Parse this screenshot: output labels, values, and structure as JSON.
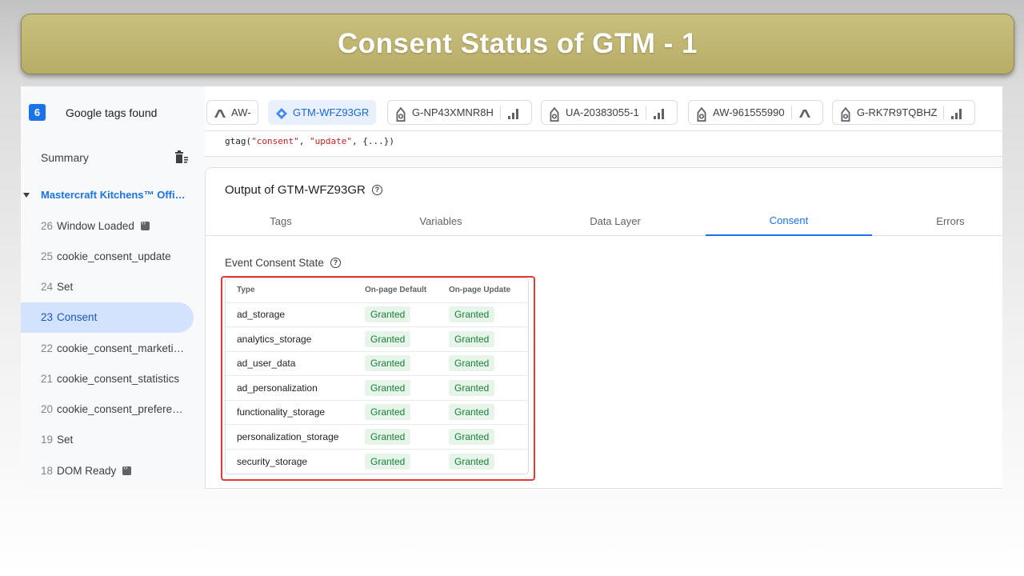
{
  "banner": {
    "title": "Consent Status of GTM - 1"
  },
  "sidebar": {
    "tags_count": "6",
    "tags_found_label": "Google tags found",
    "summary_label": "Summary",
    "container_label": "Mastercraft Kitchens™ Offi…",
    "events": [
      {
        "num": "26",
        "label": "Window Loaded",
        "code_icon": true
      },
      {
        "num": "25",
        "label": "cookie_consent_update",
        "code_icon": false
      },
      {
        "num": "24",
        "label": "Set",
        "code_icon": false
      },
      {
        "num": "23",
        "label": "Consent",
        "code_icon": false,
        "active": true
      },
      {
        "num": "22",
        "label": "cookie_consent_marketi…",
        "code_icon": false
      },
      {
        "num": "21",
        "label": "cookie_consent_statistics",
        "code_icon": false
      },
      {
        "num": "20",
        "label": "cookie_consent_prefere…",
        "code_icon": false
      },
      {
        "num": "19",
        "label": "Set",
        "code_icon": false
      },
      {
        "num": "18",
        "label": "DOM Ready",
        "code_icon": true
      }
    ]
  },
  "tag_tabs": [
    {
      "label": "AW-",
      "icon": "google-ads-icon"
    },
    {
      "label": "GTM-WFZ93GR",
      "icon": "gtm-diamond-icon",
      "active": true
    },
    {
      "label": "G-NP43XMNR8H",
      "icon": "google-tag-icon",
      "trailing_icon": "analytics-bars-icon"
    },
    {
      "label": "UA-20383055-1",
      "icon": "google-tag-icon",
      "trailing_icon": "analytics-bars-icon"
    },
    {
      "label": "AW-961555990",
      "icon": "google-tag-icon",
      "trailing_icon": "google-ads-icon"
    },
    {
      "label": "G-RK7R9TQBHZ",
      "icon": "google-tag-icon",
      "trailing_icon": "analytics-bars-icon"
    }
  ],
  "code_strip": {
    "prefix": "gtag(",
    "arg1": "\"consent\"",
    "sep": ", ",
    "arg2": "\"update\"",
    "suffix": ", {...})"
  },
  "output": {
    "title": "Output of GTM-WFZ93GR",
    "tabs": [
      "Tags",
      "Variables",
      "Data Layer",
      "Consent",
      "Errors"
    ],
    "active_tab": "Consent",
    "section_title": "Event Consent State",
    "table": {
      "headers": {
        "type": "Type",
        "default": "On-page Default",
        "update": "On-page Update"
      },
      "rows": [
        {
          "type": "ad_storage",
          "default": "Granted",
          "update": "Granted"
        },
        {
          "type": "analytics_storage",
          "default": "Granted",
          "update": "Granted"
        },
        {
          "type": "ad_user_data",
          "default": "Granted",
          "update": "Granted"
        },
        {
          "type": "ad_personalization",
          "default": "Granted",
          "update": "Granted"
        },
        {
          "type": "functionality_storage",
          "default": "Granted",
          "update": "Granted"
        },
        {
          "type": "personalization_storage",
          "default": "Granted",
          "update": "Granted"
        },
        {
          "type": "security_storage",
          "default": "Granted",
          "update": "Granted"
        }
      ]
    }
  },
  "colors": {
    "banner": "#c2b873",
    "accent": "#1a73e8",
    "granted_bg": "#e6f4ea",
    "granted_text": "#188038",
    "highlight": "#e53935"
  }
}
